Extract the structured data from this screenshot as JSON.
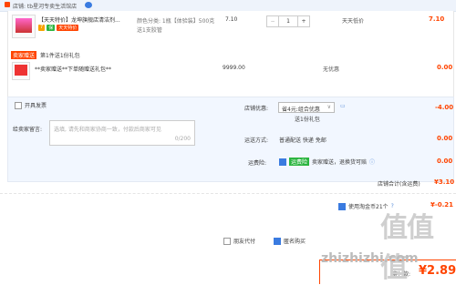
{
  "shop": {
    "label": "店铺: tb星河专卖生活馆店",
    "wangwang_icon": "wangwang-icon"
  },
  "item1": {
    "title": "【天天特价】龙坤旗舰店清洁剂...",
    "variant_line1": "颜色分类: 1瓶【体验装】500克",
    "variant_line2": "送1支胶管",
    "badges": [
      "7",
      "保",
      "天天特价"
    ],
    "unit_price": "7.10",
    "quantity": "1",
    "discount_label": "天天低价",
    "subtotal": "7.10"
  },
  "gift": {
    "header": "卖家赠送",
    "header_note": "第1件送1份礼包",
    "title": "**卖家赠送**下单随赠送礼包**",
    "price": "9999.00",
    "discount_label": "无优惠",
    "subtotal": "0.00"
  },
  "options": {
    "invoice_label": "开具发票",
    "remark_label": "给卖家留言:",
    "remark_placeholder": "选填, 请先和商家协商一致，付款后商家可见",
    "remark_counter": "0/200",
    "shop_discount_label": "店铺优惠:",
    "shop_discount_value": "省4元:组合优惠",
    "shop_discount_note": "送1份礼包",
    "shop_discount_amount": "-4.00",
    "delivery_label": "运送方式:",
    "delivery_value": "普通配送 快递 免邮",
    "delivery_amount": "0.00",
    "insurance_label": "运费险:",
    "insurance_badge": "运费险",
    "insurance_text": "卖家赠送，退换货可赔",
    "insurance_amount": "0.00",
    "shop_total_label": "店铺合计(含运费)",
    "shop_total_value": "¥3.10"
  },
  "coupon": {
    "label": "使用淘金币21个",
    "amount": "¥-0.21"
  },
  "footer": {
    "anon_label": "匿名购买",
    "friend_label": "朋友代付",
    "final_label": "实付款:",
    "final_amount": "¥2.89"
  },
  "watermark": {
    "cn": "值值值",
    "url": "zhizhizhi.com"
  },
  "colors": {
    "accent_red": "#ff4400",
    "accent_blue": "#3a7be0",
    "panel_blue": "#f2f7ff"
  }
}
